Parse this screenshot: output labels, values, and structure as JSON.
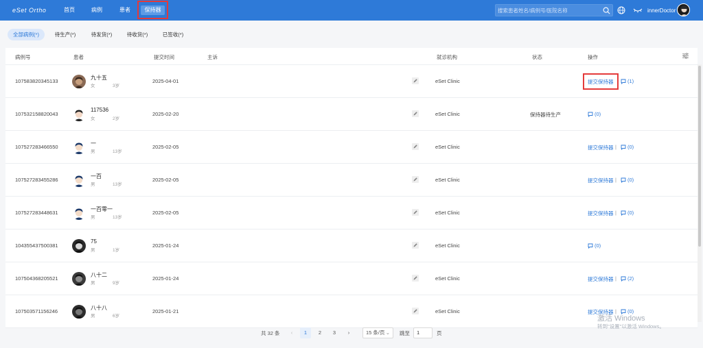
{
  "app": {
    "logo": "eSet Ortho",
    "username": "innerDoctor"
  },
  "nav": [
    "首页",
    "病例",
    "患者",
    "保持器"
  ],
  "search": {
    "placeholder": "搜索患者姓名/病例号/医院名称"
  },
  "filters": [
    "全部病例(*)",
    "待生产(*)",
    "待发货(*)",
    "待收货(*)",
    "已签收(*)"
  ],
  "table": {
    "headers": [
      "病例号",
      "患者",
      "提交时间",
      "主诉",
      "就诊机构",
      "状态",
      "操作"
    ],
    "submit_label": "提交保持器",
    "rows": [
      {
        "case_no": "107583820345133",
        "name": "九十五",
        "gender": "女",
        "age": "3岁",
        "date": "2025-04-01",
        "clinic": "eSet Clinic",
        "status": "",
        "comments": "(1)",
        "has_submit": true
      },
      {
        "case_no": "107532158820043",
        "name": "117536",
        "gender": "女",
        "age": "2岁",
        "date": "2025-02-20",
        "clinic": "eSet Clinic",
        "status": "保持器待生产",
        "comments": "(0)",
        "has_submit": false
      },
      {
        "case_no": "107527283466550",
        "name": "一",
        "gender": "男",
        "age": "13岁",
        "date": "2025-02-05",
        "clinic": "eSet Clinic",
        "status": "",
        "comments": "(0)",
        "has_submit": true
      },
      {
        "case_no": "107527283455286",
        "name": "一百",
        "gender": "男",
        "age": "13岁",
        "date": "2025-02-05",
        "clinic": "eSet Clinic",
        "status": "",
        "comments": "(0)",
        "has_submit": true
      },
      {
        "case_no": "107527283448631",
        "name": "一百零一",
        "gender": "男",
        "age": "13岁",
        "date": "2025-02-05",
        "clinic": "eSet Clinic",
        "status": "",
        "comments": "(0)",
        "has_submit": true
      },
      {
        "case_no": "104355437500381",
        "name": "75",
        "gender": "男",
        "age": "1岁",
        "date": "2025-01-24",
        "clinic": "eSet Clinic",
        "status": "",
        "comments": "(0)",
        "has_submit": false
      },
      {
        "case_no": "107504368205521",
        "name": "八十二",
        "gender": "男",
        "age": "9岁",
        "date": "2025-01-24",
        "clinic": "eSet Clinic",
        "status": "",
        "comments": "(2)",
        "has_submit": true
      },
      {
        "case_no": "107503571156246",
        "name": "八十八",
        "gender": "男",
        "age": "6岁",
        "date": "2025-01-21",
        "clinic": "eSet Clinic",
        "status": "",
        "comments": "(0)",
        "has_submit": true
      }
    ]
  },
  "pagination": {
    "total": "共 32 条",
    "pages": [
      "1",
      "2",
      "3"
    ],
    "page_size": "15 条/页",
    "jump_label": "跳至",
    "jump_value": "1",
    "page_suffix": "页"
  },
  "watermark": {
    "line1": "激活 Windows",
    "line2": "转到\"设置\"以激活 Windows。"
  }
}
